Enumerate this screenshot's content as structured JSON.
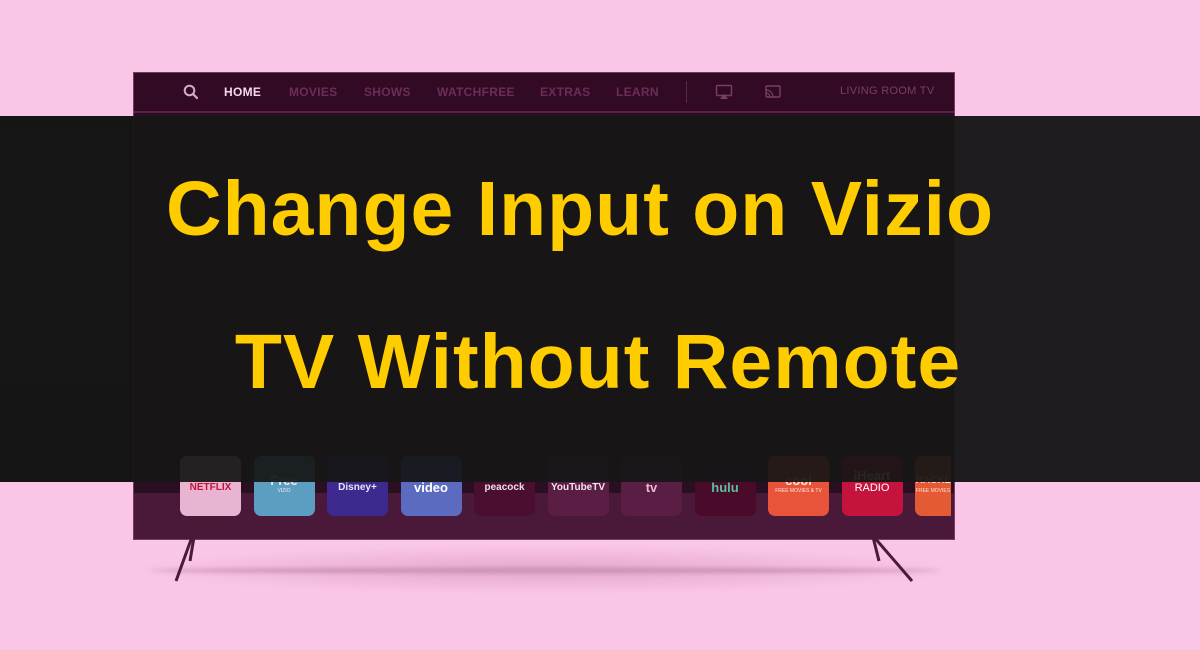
{
  "nav": {
    "items": [
      "HOME",
      "MOVIES",
      "SHOWS",
      "WATCHFREE",
      "EXTRAS",
      "LEARN"
    ],
    "active": "HOME",
    "device_label": "LIVING ROOM TV",
    "icons": [
      "search-icon",
      "airplay-icon",
      "cast-icon"
    ]
  },
  "apps": [
    {
      "name": "NETFLIX",
      "sub": "",
      "bg": "#e9b3d2",
      "fg": "#c4123a"
    },
    {
      "name": "Free",
      "sub": "VIZIO",
      "bg": "#5b9ec2",
      "fg": "#f0e6f2"
    },
    {
      "name": "Disney+",
      "sub": "",
      "bg": "#3e2a8f",
      "fg": "#e9e3f5"
    },
    {
      "name": "video",
      "sub": "",
      "bg": "#5b6bc0",
      "fg": "#ffffff"
    },
    {
      "name": "peacock",
      "sub": "",
      "bg": "#4a0f30",
      "fg": "#f1dde8"
    },
    {
      "name": "YouTubeTV",
      "sub": "",
      "bg": "#5a1e44",
      "fg": "#f3e4ee"
    },
    {
      "name": "tv",
      "sub": "",
      "bg": "#5a1e44",
      "fg": "#e9b7d4"
    },
    {
      "name": "hulu",
      "sub": "",
      "bg": "#4a0a2a",
      "fg": "#57c29a"
    },
    {
      "name": "cool",
      "sub": "FREE MOVIES & TV",
      "bg": "#e8543a",
      "fg": "#fde6e0"
    },
    {
      "name": "iHeart",
      "sub": "RADIO",
      "bg": "#c4143e",
      "fg": "#ffffff"
    },
    {
      "name": "CRACKLE",
      "sub": "FREE MOVIES",
      "bg": "#e45a35",
      "fg": "#fde2d8"
    }
  ],
  "title": {
    "line1": "Change Input on Vizio",
    "line2": "TV Without Remote",
    "color": "#ffcc00"
  },
  "colors": {
    "background": "#fac6e7",
    "banner": "#1c1b1c",
    "tv_frame": "#4a1838"
  }
}
